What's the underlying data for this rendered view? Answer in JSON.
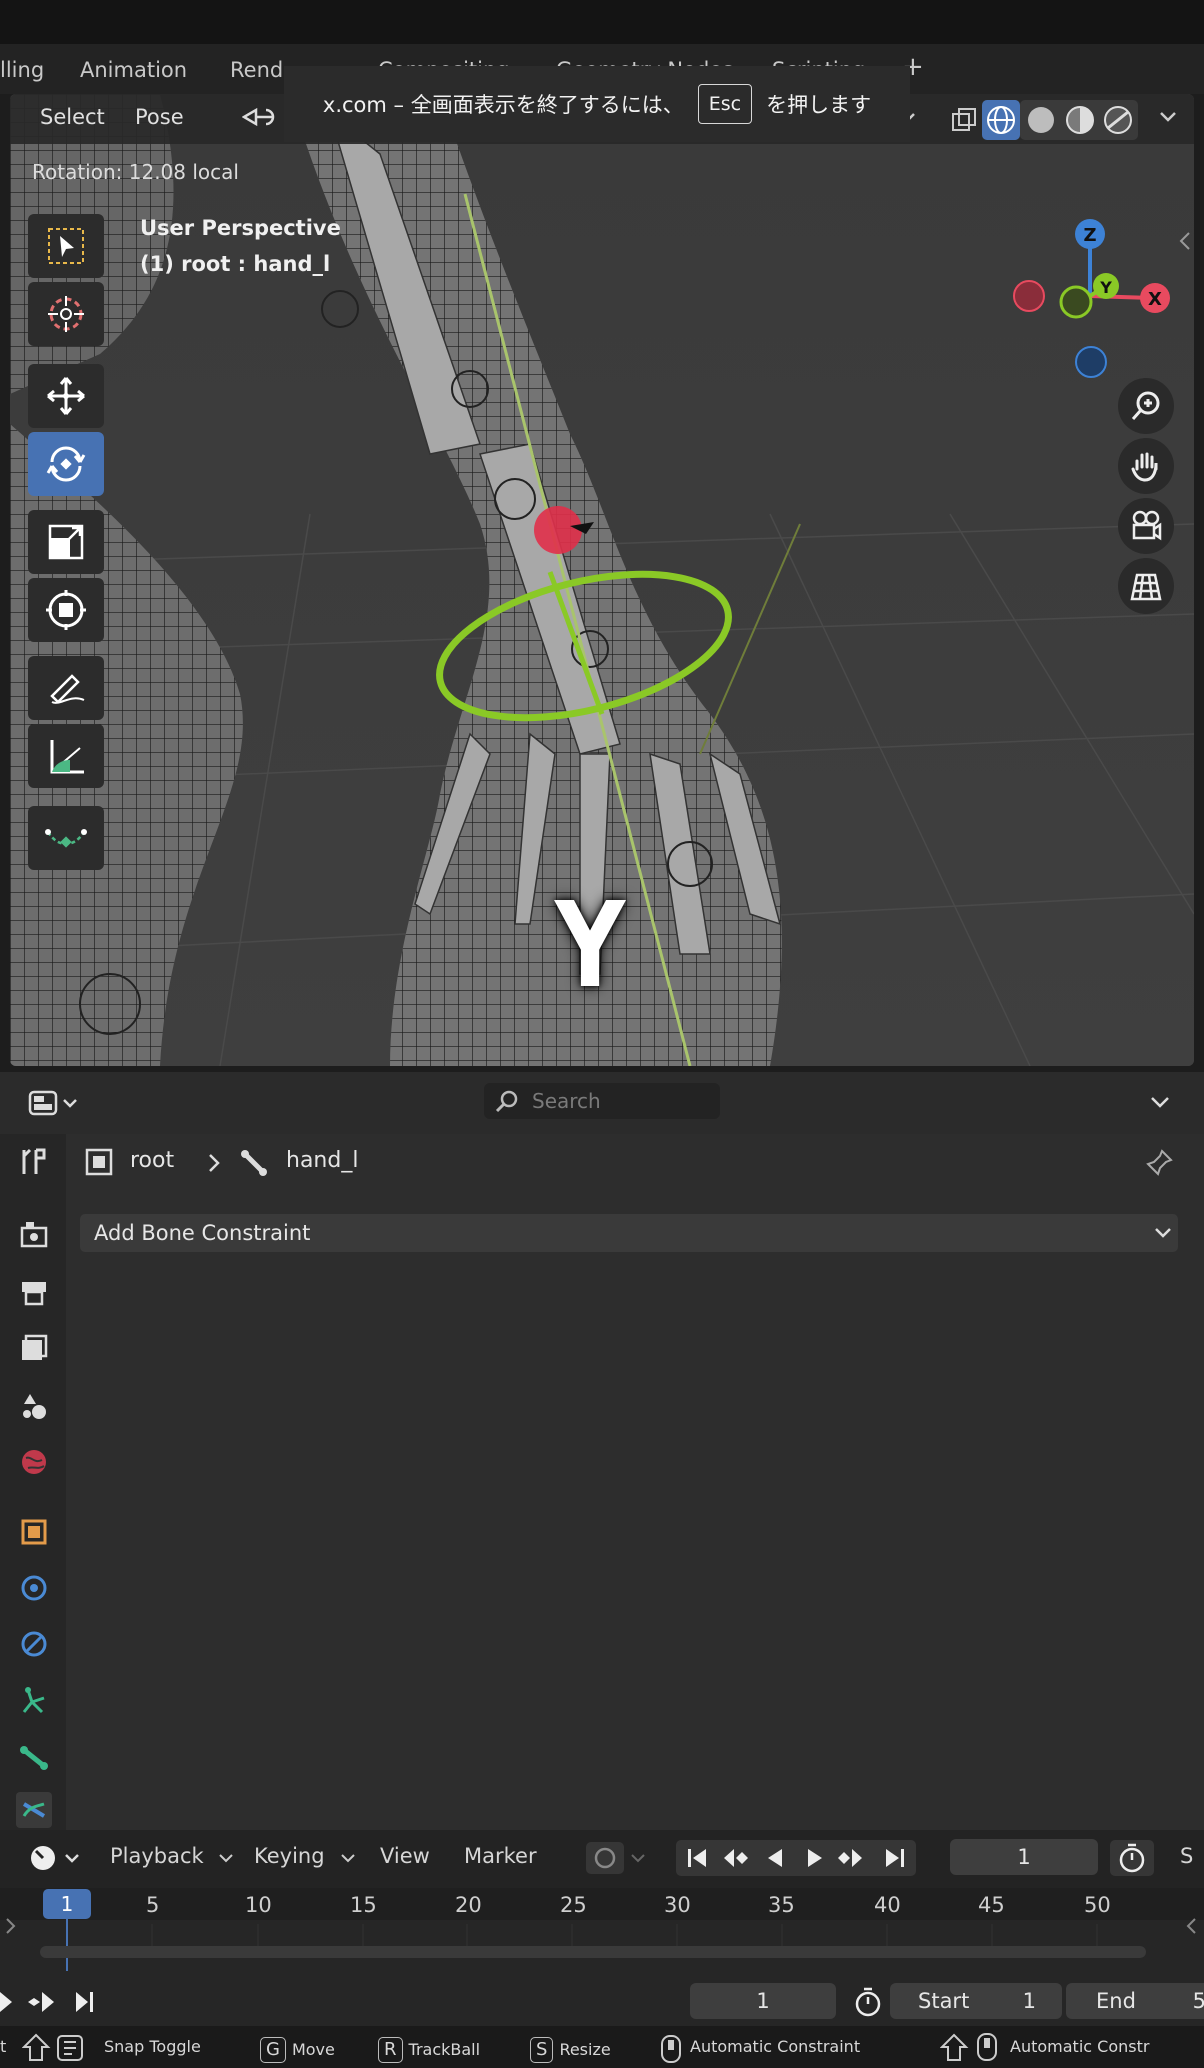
{
  "workspace_tabs": [
    "lling",
    "Animation",
    "Rend",
    "Compositing",
    "Geometry Nodes",
    "Scripting"
  ],
  "workspace_add": "+",
  "viewport": {
    "menu": [
      "Select",
      "Pose"
    ],
    "rotation_text": "Rotation: 12.08 local",
    "perspective": "User Perspective",
    "active_bone": "(1) root : hand_l",
    "gizmo_axes": {
      "z": "Z",
      "y": "Y",
      "x": "X"
    },
    "overlay_letter": "Y"
  },
  "fullscreen_notice": {
    "before": "x.com – 全画面表示を終了するには、",
    "key": "Esc",
    "after": "を押します"
  },
  "toolbar_tools": [
    "select-box",
    "cursor",
    "move",
    "rotate",
    "scale",
    "transform",
    "annotate",
    "measure",
    "relax-pose"
  ],
  "properties": {
    "search_placeholder": "Search",
    "breadcrumb_root": "root",
    "breadcrumb_bone": "hand_l",
    "add_constraint_label": "Add Bone Constraint"
  },
  "timeline": {
    "menus": [
      "Playback",
      "Keying",
      "View",
      "Marker"
    ],
    "current_frame": "1",
    "ticks": [
      "1",
      "5",
      "10",
      "15",
      "20",
      "25",
      "30",
      "35",
      "40",
      "45",
      "50"
    ],
    "next_panel_letter": "S"
  },
  "playback_bar": {
    "frame": "1",
    "start_label": "Start",
    "start_value": "1",
    "end_label": "End",
    "end_value": "5"
  },
  "status_bar": {
    "first": "t",
    "snap_toggle": "Snap Toggle",
    "move_key": "G",
    "move": "Move",
    "trackball_key": "R",
    "trackball": "TrackBall",
    "resize_key": "S",
    "resize": "Resize",
    "auto_constraint": "Automatic Constraint",
    "auto_constraint2": "Automatic Constr"
  },
  "colors": {
    "accent_blue": "#4772b3",
    "gizmo_green": "#8ac926",
    "bone_red": "#e0304a",
    "axis_x": "#e84a5f",
    "axis_y": "#8ac926",
    "axis_z": "#3d82d6"
  }
}
